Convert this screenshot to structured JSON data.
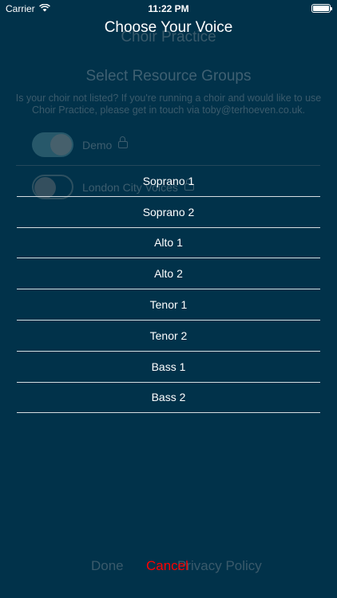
{
  "status_bar": {
    "carrier": "Carrier",
    "time": "11:22 PM"
  },
  "background": {
    "title": "Choir Practice",
    "heading": "Select Resource Groups",
    "description": "Is your choir not listed? If you're running a choir and would like to use Choir Practice, please get in touch via toby@terhoeven.co.uk.",
    "groups": [
      {
        "label": "Demo",
        "enabled": true
      },
      {
        "label": "London City Voices",
        "enabled": false
      }
    ],
    "footer": {
      "done": "Done",
      "policy": "Privacy Policy"
    }
  },
  "sheet": {
    "title": "Choose Your Voice",
    "voices": [
      "Soprano 1",
      "Soprano 2",
      "Alto 1",
      "Alto 2",
      "Tenor 1",
      "Tenor 2",
      "Bass 1",
      "Bass 2"
    ],
    "cancel_label": "Cancel"
  },
  "colors": {
    "background": "#01324a",
    "cancel": "#ff0000",
    "text": "#ffffff"
  }
}
